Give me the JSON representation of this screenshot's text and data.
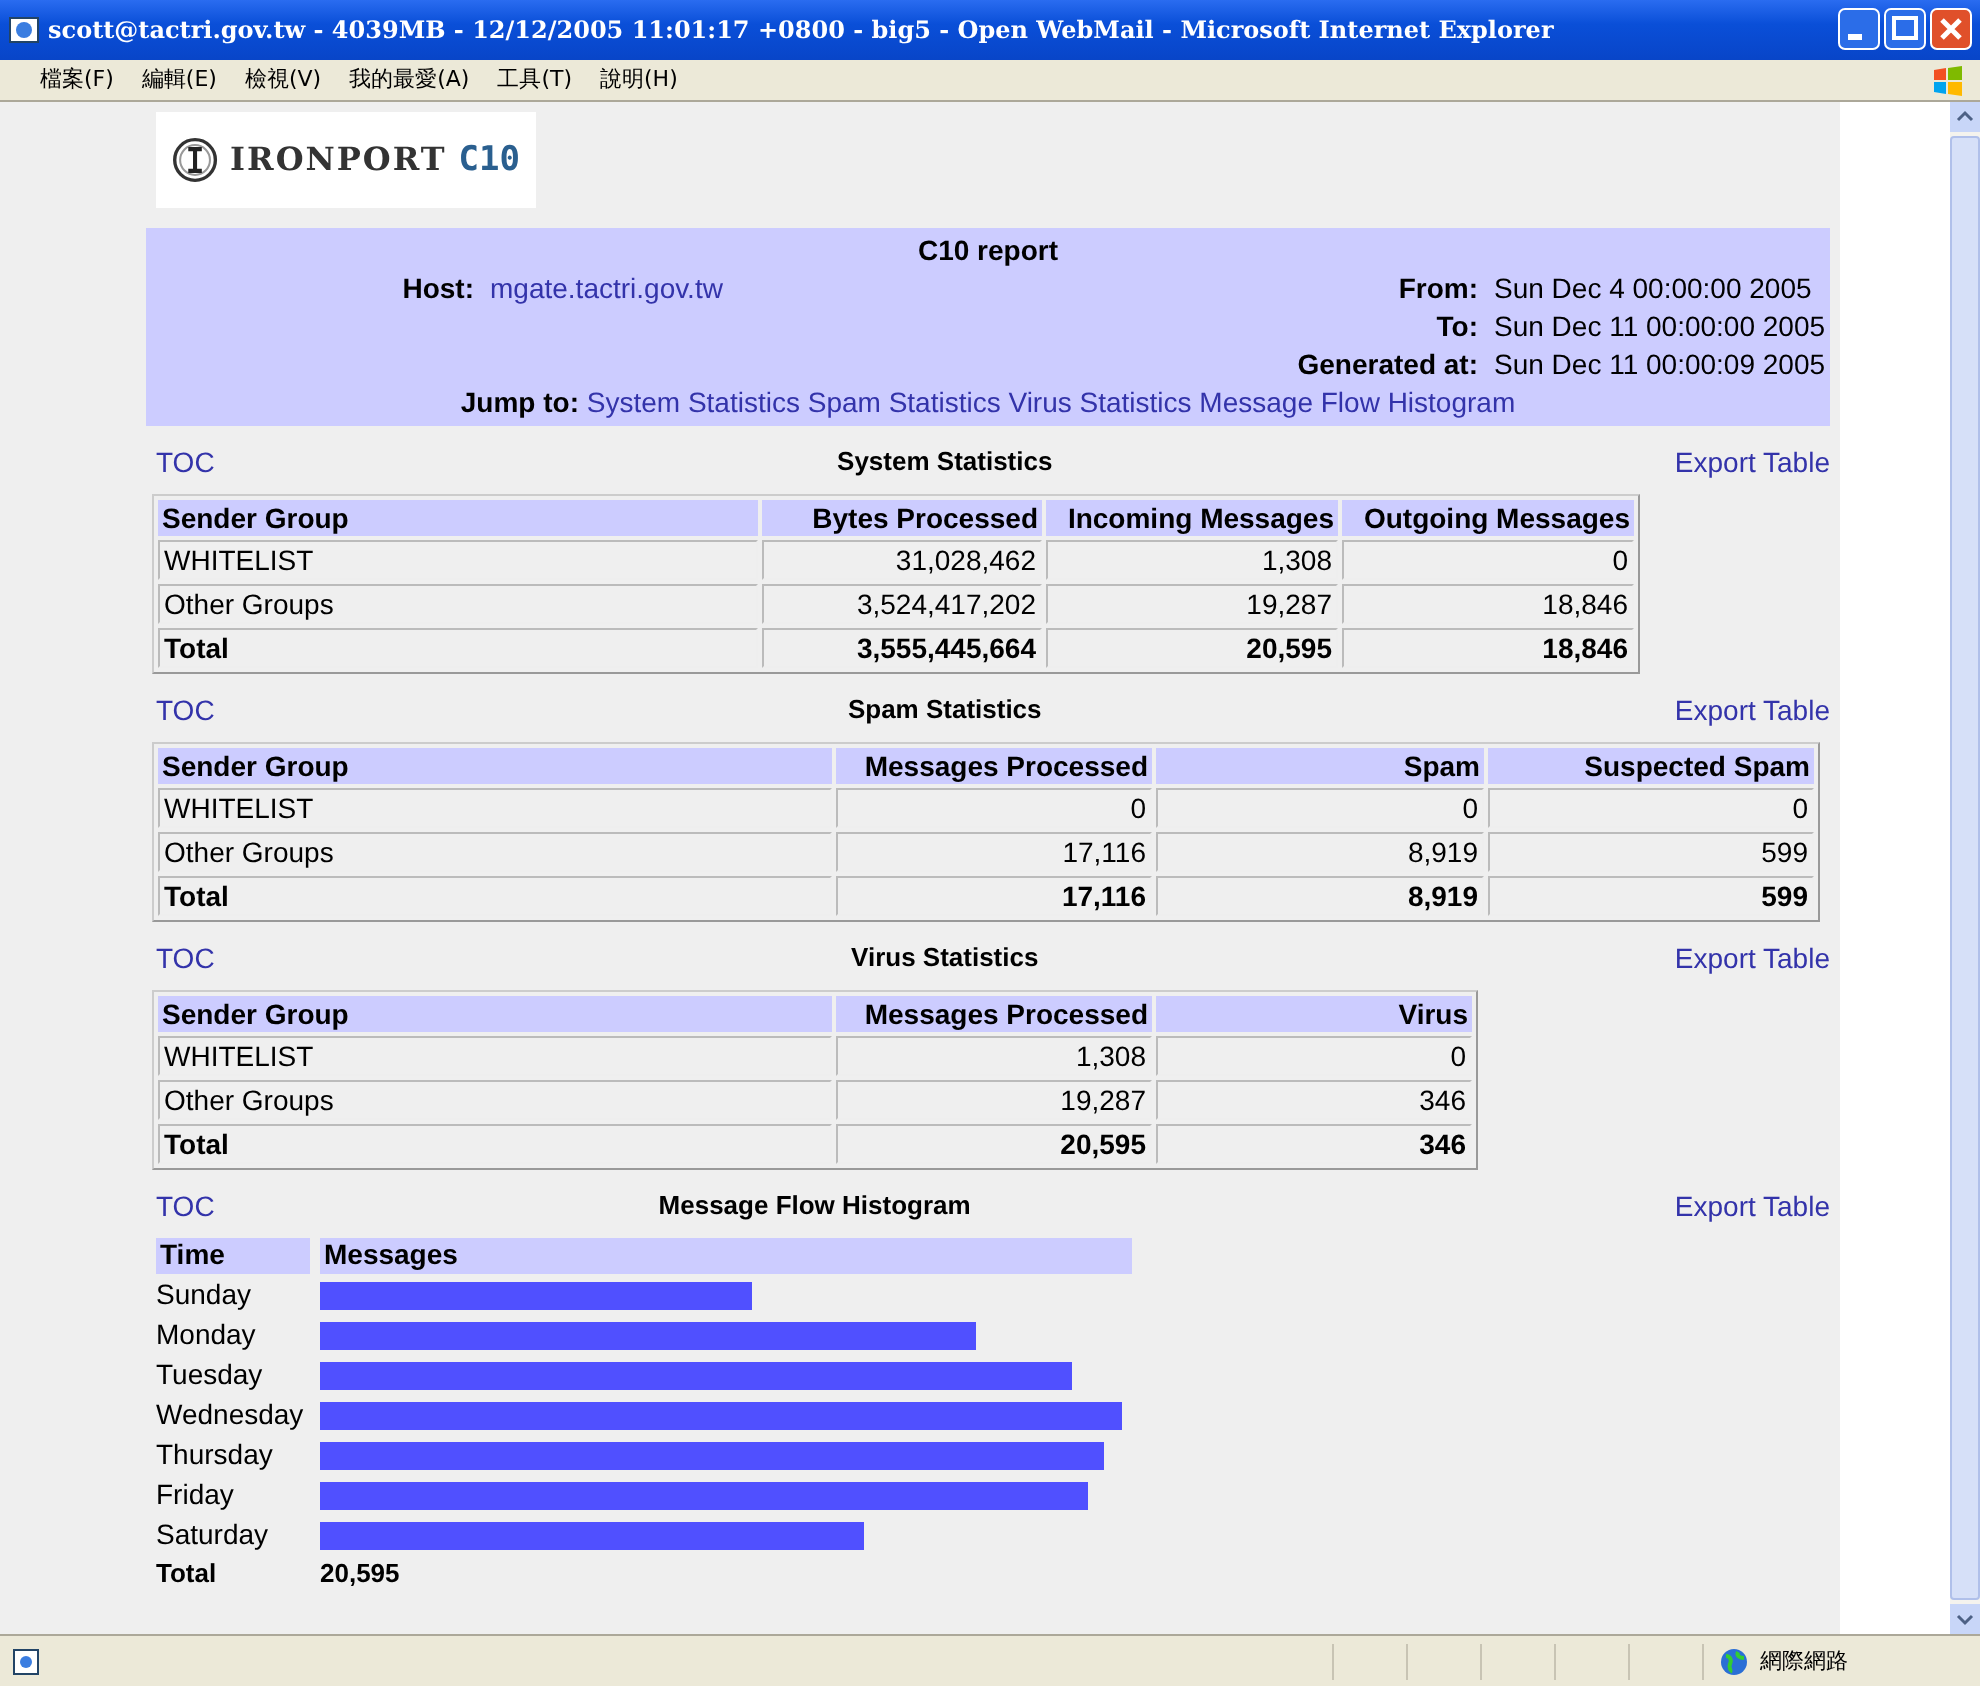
{
  "window": {
    "title": "scott@tactri.gov.tw - 4039MB - 12/12/2005 11:01:17 +0800 - big5 - Open WebMail - Microsoft Internet Explorer",
    "menu": [
      "檔案(F)",
      "編輯(E)",
      "檢視(V)",
      "我的最愛(A)",
      "工具(T)",
      "說明(H)"
    ],
    "status_zone": "網際網路"
  },
  "logo": {
    "brand": "IRONPORT",
    "model": "C10"
  },
  "report": {
    "title": "C10 report",
    "host_label": "Host:",
    "host": "mgate.tactri.gov.tw",
    "fields": [
      {
        "label": "From:",
        "value": "Sun Dec 4 00:00:00 2005"
      },
      {
        "label": "To:",
        "value": "Sun Dec 11 00:00:00 2005"
      },
      {
        "label": "Generated at:",
        "value": "Sun Dec 11 00:00:09 2005"
      }
    ],
    "jump_label": "Jump to:",
    "jump_links": [
      "System Statistics",
      "Spam Statistics",
      "Virus Statistics",
      "Message Flow Histogram"
    ]
  },
  "sections": [
    {
      "toc": "TOC",
      "title": "System Statistics",
      "export": "Export Table",
      "columns": [
        "Sender Group",
        "Bytes Processed",
        "Incoming Messages",
        "Outgoing Messages"
      ],
      "rows": [
        [
          "WHITELIST",
          "31,028,462",
          "1,308",
          "0"
        ],
        [
          "Other Groups",
          "3,524,417,202",
          "19,287",
          "18,846"
        ]
      ],
      "total": [
        "Total",
        "3,555,445,664",
        "20,595",
        "18,846"
      ]
    },
    {
      "toc": "TOC",
      "title": "Spam Statistics",
      "export": "Export Table",
      "columns": [
        "Sender Group",
        "Messages Processed",
        "Spam",
        "Suspected Spam"
      ],
      "rows": [
        [
          "WHITELIST",
          "0",
          "0",
          "0"
        ],
        [
          "Other Groups",
          "17,116",
          "8,919",
          "599"
        ]
      ],
      "total": [
        "Total",
        "17,116",
        "8,919",
        "599"
      ]
    },
    {
      "toc": "TOC",
      "title": "Virus Statistics",
      "export": "Export Table",
      "columns": [
        "Sender Group",
        "Messages Processed",
        "Virus"
      ],
      "rows": [
        [
          "WHITELIST",
          "1,308",
          "0"
        ],
        [
          "Other Groups",
          "19,287",
          "346"
        ]
      ],
      "total": [
        "Total",
        "20,595",
        "346"
      ]
    }
  ],
  "histogram": {
    "toc": "TOC",
    "title": "Message Flow Histogram",
    "export": "Export Table",
    "columns": [
      "Time",
      "Messages"
    ],
    "rows": [
      "Sunday",
      "Monday",
      "Tuesday",
      "Wednesday",
      "Thursday",
      "Friday",
      "Saturday"
    ],
    "total_label": "Total",
    "total": "20,595"
  }
}
